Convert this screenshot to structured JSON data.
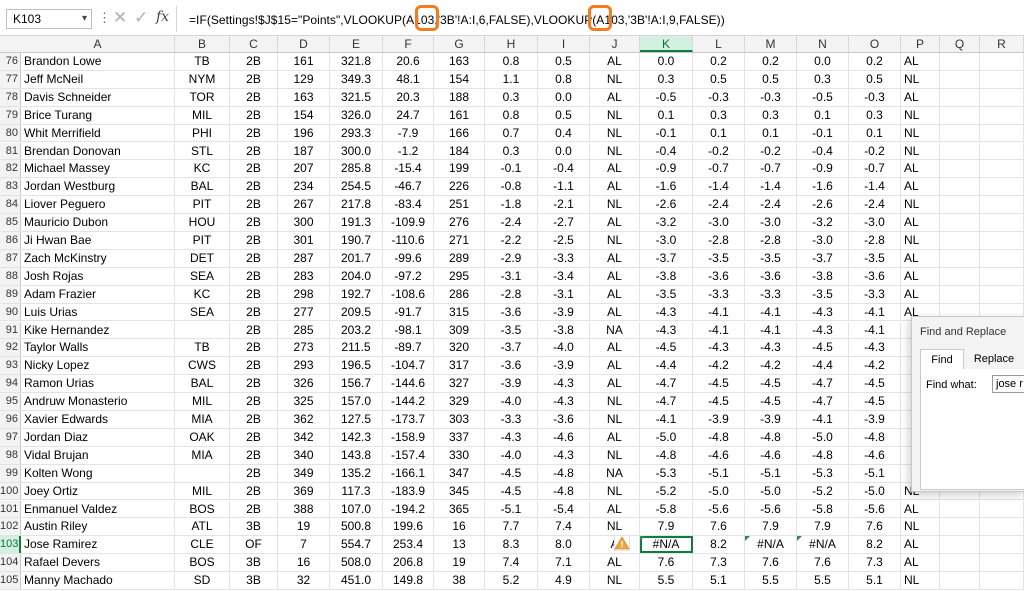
{
  "formula_bar": {
    "name_box": "K103",
    "formula_text": "=IF(Settings!$J$15=\"Points\",VLOOKUP(A103,'3B'!A:I,6,FALSE),VLOOKUP(A103,'3B'!A:I,9,FALSE))",
    "icons": [
      "more-options-icon",
      "cancel-icon",
      "enter-icon",
      "fx-icon"
    ]
  },
  "columns": [
    "A",
    "B",
    "C",
    "D",
    "E",
    "F",
    "G",
    "H",
    "I",
    "J",
    "K",
    "L",
    "M",
    "N",
    "O",
    "P",
    "Q",
    "R"
  ],
  "selected_column": "K",
  "selected_row": 103,
  "highlight_color": "#f07d22",
  "rows": [
    {
      "n": "76",
      "c": [
        "Brandon Lowe",
        "TB",
        "2B",
        "161",
        "321.8",
        "20.6",
        "163",
        "0.8",
        "0.5",
        "AL",
        "0.0",
        "0.2",
        "0.2",
        "0.0",
        "0.2",
        "AL"
      ]
    },
    {
      "n": "77",
      "c": [
        "Jeff McNeil",
        "NYM",
        "2B",
        "129",
        "349.3",
        "48.1",
        "154",
        "1.1",
        "0.8",
        "NL",
        "0.3",
        "0.5",
        "0.5",
        "0.3",
        "0.5",
        "NL"
      ]
    },
    {
      "n": "78",
      "c": [
        "Davis Schneider",
        "TOR",
        "2B",
        "163",
        "321.5",
        "20.3",
        "188",
        "0.3",
        "0.0",
        "AL",
        "-0.5",
        "-0.3",
        "-0.3",
        "-0.5",
        "-0.3",
        "AL"
      ]
    },
    {
      "n": "79",
      "c": [
        "Brice Turang",
        "MIL",
        "2B",
        "154",
        "326.0",
        "24.7",
        "161",
        "0.8",
        "0.5",
        "NL",
        "0.1",
        "0.3",
        "0.3",
        "0.1",
        "0.3",
        "NL"
      ]
    },
    {
      "n": "80",
      "c": [
        "Whit Merrifield",
        "PHI",
        "2B",
        "196",
        "293.3",
        "-7.9",
        "166",
        "0.7",
        "0.4",
        "NL",
        "-0.1",
        "0.1",
        "0.1",
        "-0.1",
        "0.1",
        "NL"
      ]
    },
    {
      "n": "81",
      "c": [
        "Brendan Donovan",
        "STL",
        "2B",
        "187",
        "300.0",
        "-1.2",
        "184",
        "0.3",
        "0.0",
        "NL",
        "-0.4",
        "-0.2",
        "-0.2",
        "-0.4",
        "-0.2",
        "NL"
      ]
    },
    {
      "n": "82",
      "c": [
        "Michael Massey",
        "KC",
        "2B",
        "207",
        "285.8",
        "-15.4",
        "199",
        "-0.1",
        "-0.4",
        "AL",
        "-0.9",
        "-0.7",
        "-0.7",
        "-0.9",
        "-0.7",
        "AL"
      ]
    },
    {
      "n": "83",
      "c": [
        "Jordan Westburg",
        "BAL",
        "2B",
        "234",
        "254.5",
        "-46.7",
        "226",
        "-0.8",
        "-1.1",
        "AL",
        "-1.6",
        "-1.4",
        "-1.4",
        "-1.6",
        "-1.4",
        "AL"
      ]
    },
    {
      "n": "84",
      "c": [
        "Liover Peguero",
        "PIT",
        "2B",
        "267",
        "217.8",
        "-83.4",
        "251",
        "-1.8",
        "-2.1",
        "NL",
        "-2.6",
        "-2.4",
        "-2.4",
        "-2.6",
        "-2.4",
        "NL"
      ]
    },
    {
      "n": "85",
      "c": [
        "Mauricio Dubon",
        "HOU",
        "2B",
        "300",
        "191.3",
        "-109.9",
        "276",
        "-2.4",
        "-2.7",
        "AL",
        "-3.2",
        "-3.0",
        "-3.0",
        "-3.2",
        "-3.0",
        "AL"
      ]
    },
    {
      "n": "86",
      "c": [
        "Ji Hwan Bae",
        "PIT",
        "2B",
        "301",
        "190.7",
        "-110.6",
        "271",
        "-2.2",
        "-2.5",
        "NL",
        "-3.0",
        "-2.8",
        "-2.8",
        "-3.0",
        "-2.8",
        "NL"
      ]
    },
    {
      "n": "87",
      "c": [
        "Zach McKinstry",
        "DET",
        "2B",
        "287",
        "201.7",
        "-99.6",
        "289",
        "-2.9",
        "-3.3",
        "AL",
        "-3.7",
        "-3.5",
        "-3.5",
        "-3.7",
        "-3.5",
        "AL"
      ]
    },
    {
      "n": "88",
      "c": [
        "Josh Rojas",
        "SEA",
        "2B",
        "283",
        "204.0",
        "-97.2",
        "295",
        "-3.1",
        "-3.4",
        "AL",
        "-3.8",
        "-3.6",
        "-3.6",
        "-3.8",
        "-3.6",
        "AL"
      ]
    },
    {
      "n": "89",
      "c": [
        "Adam Frazier",
        "KC",
        "2B",
        "298",
        "192.7",
        "-108.6",
        "286",
        "-2.8",
        "-3.1",
        "AL",
        "-3.5",
        "-3.3",
        "-3.3",
        "-3.5",
        "-3.3",
        "AL"
      ]
    },
    {
      "n": "90",
      "c": [
        "Luis Urias",
        "SEA",
        "2B",
        "277",
        "209.5",
        "-91.7",
        "315",
        "-3.6",
        "-3.9",
        "AL",
        "-4.3",
        "-4.1",
        "-4.1",
        "-4.3",
        "-4.1",
        "AL"
      ]
    },
    {
      "n": "91",
      "c": [
        "Kike Hernandez",
        "",
        "2B",
        "285",
        "203.2",
        "-98.1",
        "309",
        "-3.5",
        "-3.8",
        "NA",
        "-4.3",
        "-4.1",
        "-4.1",
        "-4.3",
        "-4.1",
        ""
      ]
    },
    {
      "n": "92",
      "c": [
        "Taylor Walls",
        "TB",
        "2B",
        "273",
        "211.5",
        "-89.7",
        "320",
        "-3.7",
        "-4.0",
        "AL",
        "-4.5",
        "-4.3",
        "-4.3",
        "-4.5",
        "-4.3",
        ""
      ]
    },
    {
      "n": "93",
      "c": [
        "Nicky Lopez",
        "CWS",
        "2B",
        "293",
        "196.5",
        "-104.7",
        "317",
        "-3.6",
        "-3.9",
        "AL",
        "-4.4",
        "-4.2",
        "-4.2",
        "-4.4",
        "-4.2",
        ""
      ]
    },
    {
      "n": "94",
      "c": [
        "Ramon Urias",
        "BAL",
        "2B",
        "326",
        "156.7",
        "-144.6",
        "327",
        "-3.9",
        "-4.3",
        "AL",
        "-4.7",
        "-4.5",
        "-4.5",
        "-4.7",
        "-4.5",
        ""
      ]
    },
    {
      "n": "95",
      "c": [
        "Andruw Monasterio",
        "MIL",
        "2B",
        "325",
        "157.0",
        "-144.2",
        "329",
        "-4.0",
        "-4.3",
        "NL",
        "-4.7",
        "-4.5",
        "-4.5",
        "-4.7",
        "-4.5",
        ""
      ]
    },
    {
      "n": "96",
      "c": [
        "Xavier Edwards",
        "MIA",
        "2B",
        "362",
        "127.5",
        "-173.7",
        "303",
        "-3.3",
        "-3.6",
        "NL",
        "-4.1",
        "-3.9",
        "-3.9",
        "-4.1",
        "-3.9",
        ""
      ]
    },
    {
      "n": "97",
      "c": [
        "Jordan Diaz",
        "OAK",
        "2B",
        "342",
        "142.3",
        "-158.9",
        "337",
        "-4.3",
        "-4.6",
        "AL",
        "-5.0",
        "-4.8",
        "-4.8",
        "-5.0",
        "-4.8",
        ""
      ]
    },
    {
      "n": "98",
      "c": [
        "Vidal Brujan",
        "MIA",
        "2B",
        "340",
        "143.8",
        "-157.4",
        "330",
        "-4.0",
        "-4.3",
        "NL",
        "-4.8",
        "-4.6",
        "-4.6",
        "-4.8",
        "-4.6",
        ""
      ]
    },
    {
      "n": "99",
      "c": [
        "Kolten Wong",
        "",
        "2B",
        "349",
        "135.2",
        "-166.1",
        "347",
        "-4.5",
        "-4.8",
        "NA",
        "-5.3",
        "-5.1",
        "-5.1",
        "-5.3",
        "-5.1",
        ""
      ]
    },
    {
      "n": "100",
      "c": [
        "Joey Ortiz",
        "MIL",
        "2B",
        "369",
        "117.3",
        "-183.9",
        "345",
        "-4.5",
        "-4.8",
        "NL",
        "-5.2",
        "-5.0",
        "-5.0",
        "-5.2",
        "-5.0",
        "NL"
      ]
    },
    {
      "n": "101",
      "c": [
        "Enmanuel Valdez",
        "BOS",
        "2B",
        "388",
        "107.0",
        "-194.2",
        "365",
        "-5.1",
        "-5.4",
        "AL",
        "-5.8",
        "-5.6",
        "-5.6",
        "-5.8",
        "-5.6",
        "AL"
      ]
    },
    {
      "n": "102",
      "c": [
        "Austin Riley",
        "ATL",
        "3B",
        "19",
        "500.8",
        "199.6",
        "16",
        "7.7",
        "7.4",
        "NL",
        "7.9",
        "7.6",
        "7.9",
        "7.9",
        "7.6",
        "NL"
      ]
    },
    {
      "n": "103",
      "c": [
        "Jose Ramirez",
        "CLE",
        "OF",
        "7",
        "554.7",
        "253.4",
        "13",
        "8.3",
        "8.0",
        "A",
        "#N/A",
        "8.2",
        "#N/A",
        "#N/A",
        "8.2",
        "AL"
      ]
    },
    {
      "n": "104",
      "c": [
        "Rafael Devers",
        "BOS",
        "3B",
        "16",
        "508.0",
        "206.8",
        "19",
        "7.4",
        "7.1",
        "AL",
        "7.6",
        "7.3",
        "7.6",
        "7.6",
        "7.3",
        "AL"
      ]
    },
    {
      "n": "105",
      "c": [
        "Manny Machado",
        "SD",
        "3B",
        "32",
        "451.0",
        "149.8",
        "38",
        "5.2",
        "4.9",
        "NL",
        "5.5",
        "5.1",
        "5.5",
        "5.5",
        "5.1",
        "NL"
      ]
    }
  ],
  "find_replace": {
    "title": "Find and Replace",
    "tab_find": "Find",
    "tab_replace": "Replace",
    "find_label": "Find what:",
    "find_value": "jose r"
  }
}
